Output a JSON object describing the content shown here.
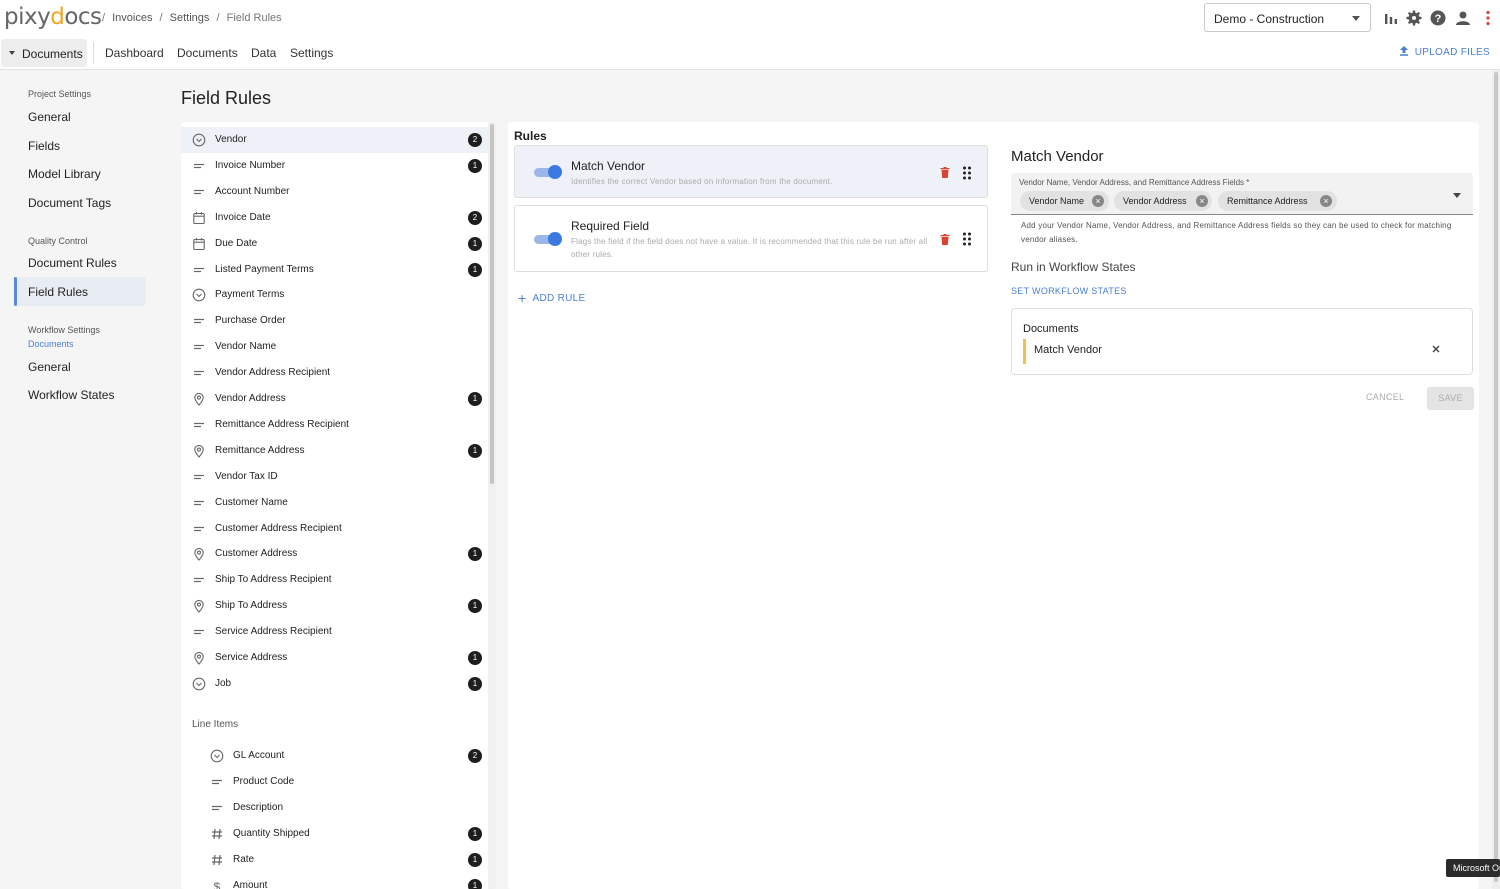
{
  "app": {
    "logo": "pixydocs",
    "breadcrumbs": [
      "Invoices",
      "Settings",
      "Field Rules"
    ],
    "project": "Demo - Construction",
    "icons": [
      "bar-chart-icon",
      "gear-icon",
      "help-icon",
      "user-icon",
      "more-vertical-icon"
    ]
  },
  "navbar": {
    "menu_label": "Documents",
    "links": [
      "Dashboard",
      "Documents",
      "Data",
      "Settings"
    ],
    "upload_label": "UPLOAD FILES"
  },
  "sidebar": {
    "sections": [
      {
        "title": "Project Settings",
        "items": [
          "General",
          "Fields",
          "Model Library",
          "Document Tags"
        ]
      },
      {
        "title": "Quality Control",
        "items": [
          "Document Rules",
          "Field Rules"
        ]
      },
      {
        "title": "Workflow Settings",
        "subtitle": "Documents",
        "items": [
          "General",
          "Workflow States"
        ]
      }
    ],
    "active_item": "Field Rules"
  },
  "page": {
    "title": "Field Rules"
  },
  "fields": [
    {
      "name": "Vendor",
      "icon": "circle-chevron-icon",
      "count": "2",
      "active": true
    },
    {
      "name": "Invoice Number",
      "icon": "text-lines-icon",
      "count": "1"
    },
    {
      "name": "Account Number",
      "icon": "text-lines-icon",
      "count": ""
    },
    {
      "name": "Invoice Date",
      "icon": "calendar-icon",
      "count": "2"
    },
    {
      "name": "Due Date",
      "icon": "calendar-icon",
      "count": "1"
    },
    {
      "name": "Listed Payment Terms",
      "icon": "text-lines-icon",
      "count": "1"
    },
    {
      "name": "Payment Terms",
      "icon": "circle-chevron-icon",
      "count": ""
    },
    {
      "name": "Purchase Order",
      "icon": "text-lines-icon",
      "count": ""
    },
    {
      "name": "Vendor Name",
      "icon": "text-lines-icon",
      "count": ""
    },
    {
      "name": "Vendor Address Recipient",
      "icon": "text-lines-icon",
      "count": ""
    },
    {
      "name": "Vendor Address",
      "icon": "location-pin-icon",
      "count": "1"
    },
    {
      "name": "Remittance Address Recipient",
      "icon": "text-lines-icon",
      "count": ""
    },
    {
      "name": "Remittance Address",
      "icon": "location-pin-icon",
      "count": "1"
    },
    {
      "name": "Vendor Tax ID",
      "icon": "text-lines-icon",
      "count": ""
    },
    {
      "name": "Customer Name",
      "icon": "text-lines-icon",
      "count": ""
    },
    {
      "name": "Customer Address Recipient",
      "icon": "text-lines-icon",
      "count": ""
    },
    {
      "name": "Customer Address",
      "icon": "location-pin-icon",
      "count": "1"
    },
    {
      "name": "Ship To Address Recipient",
      "icon": "text-lines-icon",
      "count": ""
    },
    {
      "name": "Ship To Address",
      "icon": "location-pin-icon",
      "count": "1"
    },
    {
      "name": "Service Address Recipient",
      "icon": "text-lines-icon",
      "count": ""
    },
    {
      "name": "Service Address",
      "icon": "location-pin-icon",
      "count": "1"
    },
    {
      "name": "Job",
      "icon": "circle-chevron-icon",
      "count": "1"
    }
  ],
  "line_items": {
    "title": "Line Items",
    "fields": [
      {
        "name": "GL Account",
        "icon": "circle-chevron-icon",
        "count": "2"
      },
      {
        "name": "Product Code",
        "icon": "text-lines-icon",
        "count": ""
      },
      {
        "name": "Description",
        "icon": "text-lines-icon",
        "count": ""
      },
      {
        "name": "Quantity Shipped",
        "icon": "hash-icon",
        "count": "1"
      },
      {
        "name": "Rate",
        "icon": "hash-icon",
        "count": "1"
      },
      {
        "name": "Amount",
        "icon": "dollar-icon",
        "count": "1"
      }
    ]
  },
  "rules": {
    "title": "Rules",
    "items": [
      {
        "title": "Match Vendor",
        "description": "Identifies the correct Vendor based on information from the document.",
        "enabled": true,
        "selected": true
      },
      {
        "title": "Required Field",
        "description": "Flags the field if the field does not have a value. It is recommended that this rule be run after all other rules.",
        "enabled": true,
        "selected": false
      }
    ],
    "add_label": "ADD RULE"
  },
  "editor": {
    "title": "Match Vendor",
    "fields_label": "Vendor Name, Vendor Address, and Remittance Address Fields *",
    "chips": [
      "Vendor Name",
      "Vendor Address",
      "Remittance Address"
    ],
    "helper": "Add your Vendor Name, Vendor Address, and Remittance Address fields so they can be used to check for matching vendor aliases.",
    "run_title": "Run in Workflow States",
    "set_states_label": "SET WORKFLOW STATES",
    "workflow_group": "Documents",
    "workflow_item": "Match Vendor",
    "cancel_label": "CANCEL",
    "save_label": "SAVE"
  },
  "tooltip": "Microsoft Outlook",
  "colors": {
    "accent": "#4a7fd4",
    "logo_accent": "#f4a41f",
    "toggle_on": "#3b78e0",
    "delete": "#d9432f",
    "badge": "#1e1e1e"
  }
}
